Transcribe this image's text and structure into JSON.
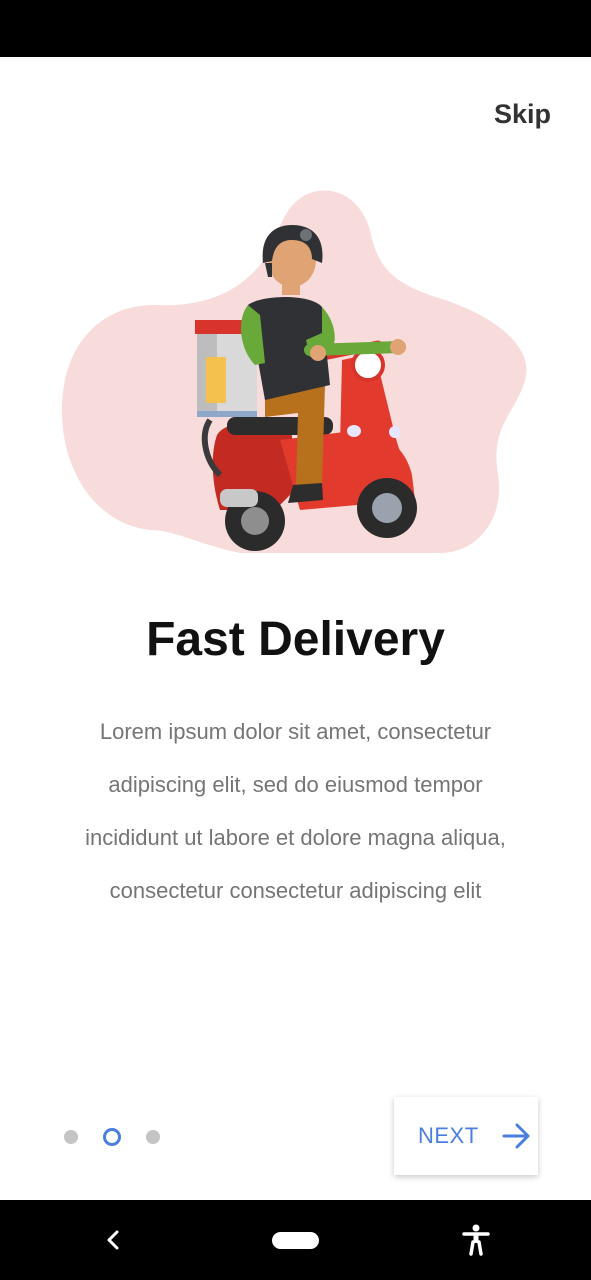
{
  "header": {
    "skip_label": "Skip"
  },
  "onboarding": {
    "illustration": "delivery-scooter-rider",
    "title": "Fast Delivery",
    "lines": [
      "Lorem ipsum dolor sit amet, consectetur",
      "adipiscing elit, sed do eiusmod tempor",
      "incididunt ut labore et dolore magna aliqua,",
      "consectetur  consectetur adipiscing elit"
    ]
  },
  "pager": {
    "page_count": 3,
    "active_index": 1
  },
  "footer": {
    "next_label": "NEXT",
    "next_icon": "arrow-right-icon"
  },
  "nav_bar": {
    "icons": [
      "back-icon",
      "home-pill",
      "accessibility-icon"
    ]
  },
  "colors": {
    "accent": "#4a7ee0",
    "blob": "#f8dcdc",
    "scooter": "#e23b2e",
    "dot_inactive": "#c4c4c4"
  }
}
